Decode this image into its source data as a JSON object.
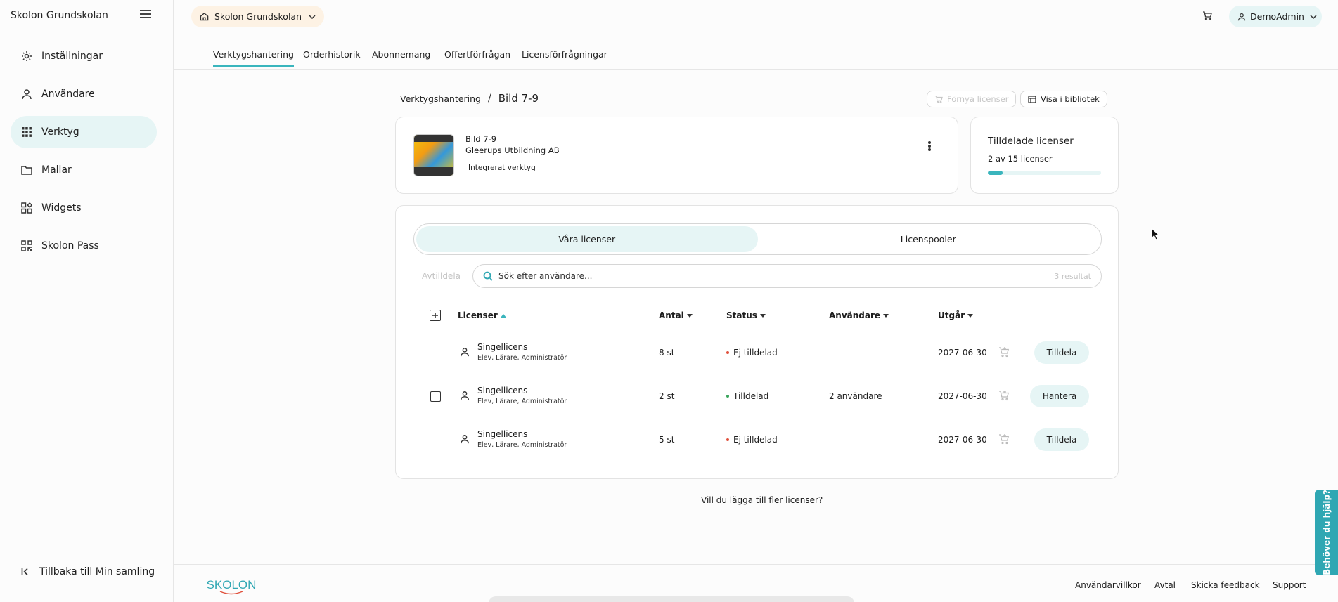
{
  "sidebar": {
    "title": "Skolon Grundskolan",
    "items": [
      {
        "label": "Inställningar",
        "icon": "gear-icon",
        "active": false
      },
      {
        "label": "Användare",
        "icon": "user-icon",
        "active": false
      },
      {
        "label": "Verktyg",
        "icon": "grid-icon",
        "active": true
      },
      {
        "label": "Mallar",
        "icon": "folder-icon",
        "active": false
      },
      {
        "label": "Widgets",
        "icon": "widgets-icon",
        "active": false
      },
      {
        "label": "Skolon Pass",
        "icon": "qr-icon",
        "active": false
      }
    ],
    "back_label": "Tillbaka till Min samling"
  },
  "header": {
    "school": "Skolon Grundskolan",
    "user": "DemoAdmin"
  },
  "tabs": [
    "Verktygshantering",
    "Orderhistorik",
    "Abonnemang",
    "Offertförfrågan",
    "Licensförfrågningar"
  ],
  "breadcrumb": {
    "parent": "Verktygshantering",
    "separator": "/",
    "current": "Bild 7-9"
  },
  "actions": {
    "renew": "Förnya licenser",
    "library": "Visa i bibliotek"
  },
  "tool": {
    "name": "Bild 7-9",
    "publisher": "Gleerups Utbildning AB",
    "badge": "Integrerat verktyg"
  },
  "assigned": {
    "title": "Tilldelade licenser",
    "count_text": "2 av 15 licenser",
    "assigned": 2,
    "total": 15
  },
  "segments": {
    "ours": "Våra licenser",
    "pools": "Licenspooler"
  },
  "toolbar": {
    "unassign": "Avtilldela",
    "search_placeholder": "Sök efter användare...",
    "result_count": "3 resultat"
  },
  "columns": {
    "licenses": "Licenser",
    "qty": "Antal",
    "status": "Status",
    "users": "Användare",
    "expires": "Utgår"
  },
  "rows": [
    {
      "name": "Singellicens",
      "roles": "Elev, Lärare, Administratör",
      "qty": "8 st",
      "status": "Ej tilldelad",
      "status_color": "#e0503c",
      "users": "—",
      "expires": "2027-06-30",
      "action": "Tilldela"
    },
    {
      "name": "Singellicens",
      "roles": "Elev, Lärare, Administratör",
      "qty": "2 st",
      "status": "Tilldelad",
      "status_color": "#3aa55c",
      "users": "2 användare",
      "expires": "2027-06-30",
      "action": "Hantera"
    },
    {
      "name": "Singellicens",
      "roles": "Elev, Lärare, Administratör",
      "qty": "5 st",
      "status": "Ej tilldelad",
      "status_color": "#e0503c",
      "users": "—",
      "expires": "2027-06-30",
      "action": "Tilldela"
    }
  ],
  "more_licenses": "Vill du lägga till fler licenser?",
  "footer": {
    "logo": "SKOLON",
    "links": [
      "Användarvillkor",
      "Avtal",
      "Skicka feedback",
      "Support"
    ]
  },
  "help": "Behöver du hjälp?",
  "colors": {
    "accent": "#3ab5bd",
    "accent_light": "#e6f5f5",
    "school_pill": "#fdf2e4",
    "help_tab": "#2fa7b3"
  }
}
